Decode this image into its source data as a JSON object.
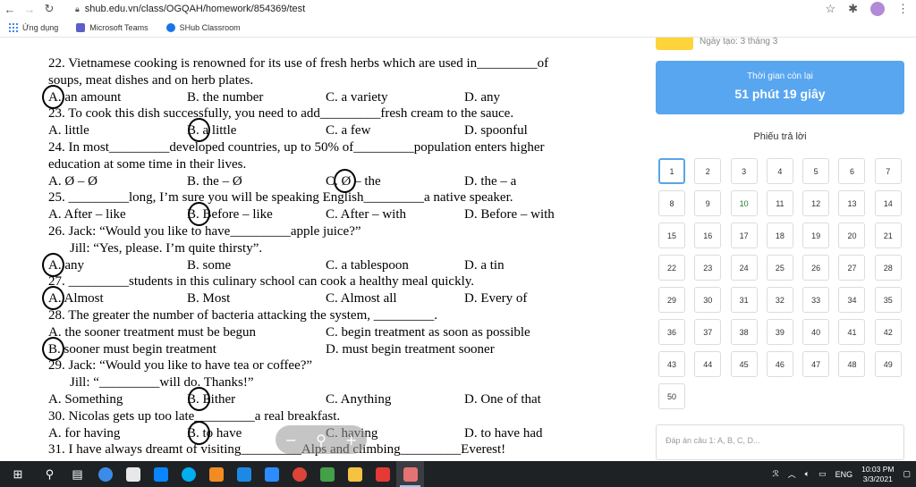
{
  "browser": {
    "url": "shub.edu.vn/class/OGQAH/homework/854369/test",
    "bookmarks": [
      {
        "label": "Ứng dụng",
        "icon": "apps-grid-icon"
      },
      {
        "label": "Microsoft Teams",
        "icon": "teams-icon"
      },
      {
        "label": "SHub Classroom",
        "icon": "shub-icon"
      }
    ]
  },
  "document": {
    "lines": [
      {
        "kind": "text",
        "text": "22. Vietnamese cooking is renowned for its use of fresh herbs which are used in_________of"
      },
      {
        "kind": "text",
        "text": "soups, meat dishes and on herb plates."
      },
      {
        "kind": "opts4",
        "options": [
          "A. an amount",
          "B. the number",
          "C. a variety",
          "D. any"
        ],
        "circled": 0
      },
      {
        "kind": "text",
        "text": "23. To cook this dish successfully, you need to add_________fresh cream to the sauce."
      },
      {
        "kind": "opts4",
        "options": [
          "A. little",
          "B. a little",
          "C. a few",
          "D. spoonful"
        ],
        "circled": 1
      },
      {
        "kind": "text",
        "text": "24. In most_________developed countries, up to 50% of_________population enters higher"
      },
      {
        "kind": "text",
        "text": "education at some time in their lives."
      },
      {
        "kind": "opts4",
        "options": [
          "A. Ø – Ø",
          "B. the – Ø",
          "C. Ø – the",
          "D. the – a"
        ],
        "circled": 2
      },
      {
        "kind": "text",
        "text": "25. _________long, I’m sure you will be speaking English_________a native speaker."
      },
      {
        "kind": "opts4",
        "options": [
          "A. After – like",
          "B. Before – like",
          "C. After – with",
          "D. Before – with"
        ],
        "circled": 1
      },
      {
        "kind": "text",
        "text": "26. Jack: “Would you like to have_________apple juice?”"
      },
      {
        "kind": "indent",
        "text": "Jill: “Yes, please. I’m quite thirsty”."
      },
      {
        "kind": "opts4",
        "options": [
          "A. any",
          "B. some",
          "C. a tablespoon",
          "D. a tin"
        ],
        "circled": 0
      },
      {
        "kind": "text",
        "text": "27. _________students in this culinary school can cook a healthy meal quickly."
      },
      {
        "kind": "opts4",
        "options": [
          "A. Almost",
          "B. Most",
          "C. Almost all",
          "D. Every of"
        ],
        "circled": 0
      },
      {
        "kind": "text",
        "text": "28. The greater the number of bacteria attacking the system, _________."
      },
      {
        "kind": "opts2",
        "options": [
          "A. the sooner treatment must be begun",
          "C. begin treatment as soon as possible"
        ],
        "circled": -1
      },
      {
        "kind": "opts2",
        "options": [
          "B. sooner must begin treatment",
          "D. must begin treatment sooner"
        ],
        "circled": 0
      },
      {
        "kind": "text",
        "text": "29. Jack: “Would you like to have tea or coffee?”"
      },
      {
        "kind": "indent",
        "text": "Jill: “_________will do. Thanks!”"
      },
      {
        "kind": "opts4",
        "options": [
          "A. Something",
          "B. Either",
          "C. Anything",
          "D. One of that"
        ],
        "circled": 1
      },
      {
        "kind": "text",
        "text": "30. Nicolas gets up too late_________a real breakfast."
      },
      {
        "kind": "opts4",
        "options": [
          "A. for having",
          "B. to have",
          "C. having",
          "D. to have had"
        ],
        "circled": 1
      },
      {
        "kind": "text",
        "text": "31. I have always dreamt of visiting_________Alps and climbing_________Everest!"
      }
    ],
    "zoom_controls": {
      "minus": "−",
      "zoom": "⚲",
      "plus": "+"
    }
  },
  "panel": {
    "date_note": "Ngày tạo: 3 tháng 3",
    "timer_label": "Thời gian còn lại",
    "timer_value": "51 phút 19 giây",
    "sheet_title": "Phiếu trả lời",
    "questions": [
      "1",
      "2",
      "3",
      "4",
      "5",
      "6",
      "7",
      "8",
      "9",
      "10",
      "11",
      "12",
      "13",
      "14",
      "15",
      "16",
      "17",
      "18",
      "19",
      "20",
      "21",
      "22",
      "23",
      "24",
      "25",
      "26",
      "27",
      "28",
      "29",
      "30",
      "31",
      "32",
      "33",
      "34",
      "35",
      "36",
      "37",
      "38",
      "39",
      "40",
      "41",
      "42",
      "43",
      "44",
      "45",
      "46",
      "47",
      "48",
      "49",
      "50"
    ],
    "active_question": "1",
    "answer_placeholder": "Đáp án câu 1: A, B, C, D...",
    "colors": {
      "timer_bg": "#58a6f0",
      "badge": "#ffd43b",
      "active_border": "#5aa4ea"
    }
  },
  "taskbar": {
    "apps": [
      "windows-start-icon",
      "search-icon",
      "task-view-icon",
      "edge-icon",
      "store-icon",
      "zalo-icon",
      "skype-icon",
      "vpn-icon",
      "mail-icon",
      "zoom-icon",
      "chrome-icon",
      "green-app-icon",
      "file-explorer-icon",
      "paint-icon",
      "snip-icon"
    ],
    "lang": "ENG",
    "time": "10:03 PM",
    "date": "3/3/2021"
  }
}
